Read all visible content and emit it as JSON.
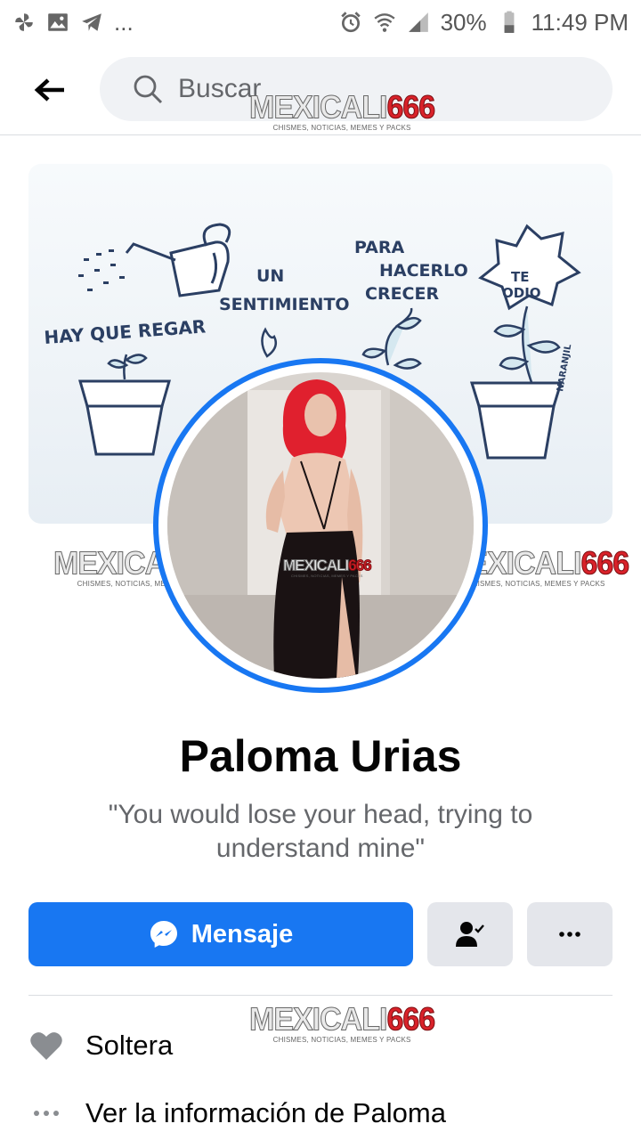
{
  "status_bar": {
    "dots": "...",
    "battery": "30%",
    "time": "11:49 PM",
    "icons_left": [
      "pinwheel-icon",
      "gallery-icon",
      "telegram-icon"
    ],
    "icons_right": [
      "alarm-icon",
      "wifi-icon",
      "signal-icon",
      "battery-icon"
    ]
  },
  "header": {
    "search_placeholder": "Buscar"
  },
  "watermark": {
    "brand_a": "MEXICALI",
    "brand_b": "666",
    "tagline": "CHISMES, NOTICIAS, MEMES Y PACKS"
  },
  "cover": {
    "text_1": "HAY QUE REGAR",
    "text_2": "UN",
    "text_3": "SENTIMIENTO",
    "text_4": "PARA",
    "text_5": "HACERLO",
    "text_6": "CRECER",
    "text_7": "TE",
    "text_8": "ODIO",
    "signature": "NARANJIL"
  },
  "profile": {
    "name": "Paloma Urias",
    "bio": "\"You would lose your head, trying to understand mine\""
  },
  "actions": {
    "message_label": "Mensaje"
  },
  "details": {
    "relationship": "Soltera",
    "see_info": "Ver la información de Paloma"
  },
  "colors": {
    "accent": "#1877f2",
    "gray_button": "#e4e6eb",
    "secondary_text": "#65676b"
  }
}
